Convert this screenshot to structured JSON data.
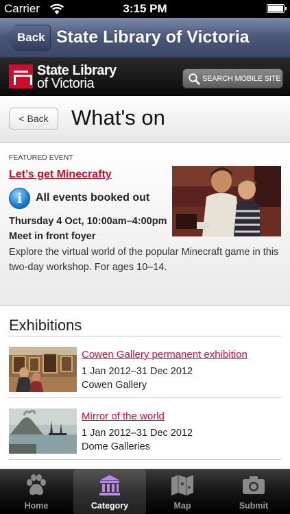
{
  "status_bar": {
    "carrier": "Carrier",
    "time": "3:15 PM"
  },
  "nav_bar": {
    "back_label": "Back",
    "title": "State Library of Victoria"
  },
  "site_header": {
    "logo_line1": "State Library",
    "logo_line2": "of Victoria",
    "search_label": "SEARCH MOBILE SITE"
  },
  "page": {
    "back_label": "< Back",
    "title": "What's on"
  },
  "featured": {
    "label": "FEATURED EVENT",
    "title": "Let’s get Minecrafty",
    "status": "All events booked out",
    "date": "Thursday 4 Oct, 10:00am–4:00pm",
    "location": "Meet in front foyer",
    "description": "Explore the virtual world of the popular Minecraft game in this two-day workshop. For ages 10–14."
  },
  "exhibitions": {
    "heading": "Exhibitions",
    "items": [
      {
        "title": "Cowen Gallery permanent exhibition",
        "dates": "1 Jan 2012–31 Dec 2012",
        "venue": "Cowen Gallery"
      },
      {
        "title": "Mirror of the world",
        "dates": "1 Jan 2012–31 Dec 2012",
        "venue": "Dome Galleries"
      }
    ]
  },
  "tab_bar": {
    "selected": "Category",
    "tabs": [
      {
        "label": "Home",
        "icon": "paw-icon"
      },
      {
        "label": "Category",
        "icon": "library-icon"
      },
      {
        "label": "Map",
        "icon": "map-icon"
      },
      {
        "label": "Submit",
        "icon": "camera-icon"
      }
    ]
  },
  "colors": {
    "accent_red": "#c8102e",
    "nav_blue": "#4a5679",
    "info_blue": "#1a7ad1"
  }
}
